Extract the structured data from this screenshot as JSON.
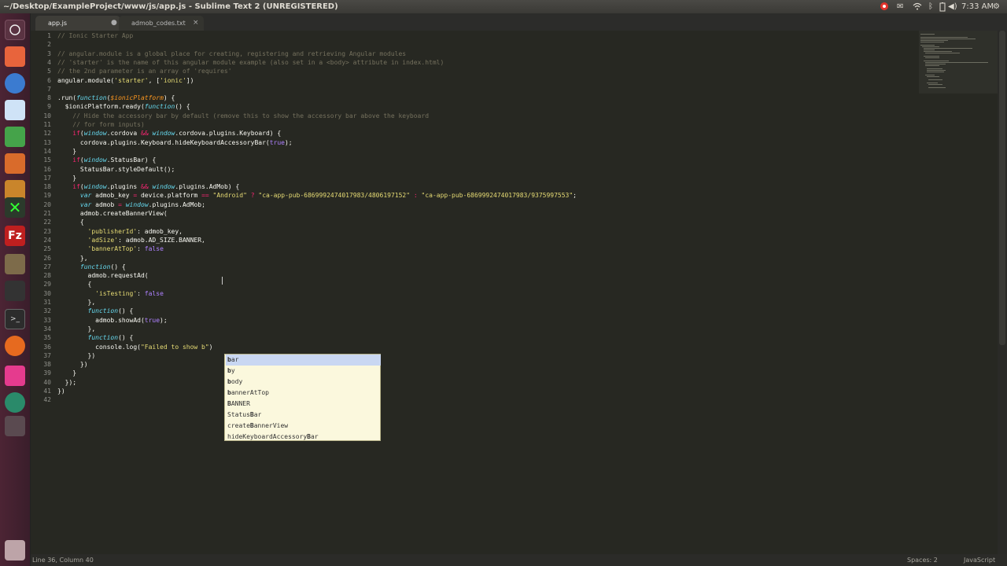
{
  "window": {
    "title": "~/Desktop/ExampleProject/www/js/app.js - Sublime Text 2 (UNREGISTERED)"
  },
  "tray": {
    "time": "7:33 AM",
    "icons": [
      "power-record-icon",
      "mail-icon",
      "wifi-icon",
      "bluetooth-icon",
      "battery-icon",
      "volume-icon",
      "settings-gear-icon"
    ]
  },
  "launcher": {
    "icons": [
      "dash-icon",
      "files-icon",
      "chromium-icon",
      "text-editor-icon",
      "spreadsheet-icon",
      "presentation-icon",
      "software-center-icon",
      "xterm-icon",
      "filezilla-icon",
      "gimp-icon",
      "network-tool-icon",
      "terminal-icon",
      "firefox-icon",
      "flickr-icon",
      "color-app-icon",
      "workspace-icon",
      "trash-icon"
    ]
  },
  "tabs": [
    {
      "label": "app.js",
      "dirty_marker": "●"
    },
    {
      "label": "admob_codes.txt",
      "close": "×"
    }
  ],
  "code_lines": [
    {
      "n": "1",
      "html": "<span class=\"c\">// Ionic Starter App</span>"
    },
    {
      "n": "2",
      "html": ""
    },
    {
      "n": "3",
      "html": "<span class=\"c\">// angular.module is a global place for creating, registering and retrieving Angular modules</span>"
    },
    {
      "n": "4",
      "html": "<span class=\"c\">// 'starter' is the name of this angular module example (also set in a &lt;body&gt; attribute in index.html)</span>"
    },
    {
      "n": "5",
      "html": "<span class=\"c\">// the 2nd parameter is an array of 'requires'</span>"
    },
    {
      "n": "6",
      "html": "angular.module(<span class=\"s\">'starter'</span>, [<span class=\"s\">'ionic'</span>])"
    },
    {
      "n": "7",
      "html": ""
    },
    {
      "n": "8",
      "html": ".run(<span class=\"i\">function</span>(<span class=\"p\">$ionicPlatform</span>) {"
    },
    {
      "n": "9",
      "html": "  $ionicPlatform.ready(<span class=\"i\">function</span>() {"
    },
    {
      "n": "10",
      "html": "    <span class=\"c\">// Hide the accessory bar by default (remove this to show the accessory bar above the keyboard</span>"
    },
    {
      "n": "11",
      "html": "    <span class=\"c\">// for form inputs)</span>"
    },
    {
      "n": "12",
      "html": "    <span class=\"k\">if</span>(<span class=\"i\">window</span>.cordova <span class=\"k\">&amp;&amp;</span> <span class=\"i\">window</span>.cordova.plugins.Keyboard) {"
    },
    {
      "n": "13",
      "html": "      cordova.plugins.Keyboard.hideKeyboardAccessoryBar(<span class=\"n\">true</span>);"
    },
    {
      "n": "14",
      "html": "    }"
    },
    {
      "n": "15",
      "html": "    <span class=\"k\">if</span>(<span class=\"i\">window</span>.StatusBar) {"
    },
    {
      "n": "16",
      "html": "      StatusBar.styleDefault();"
    },
    {
      "n": "17",
      "html": "    }"
    },
    {
      "n": "18",
      "html": "    <span class=\"k\">if</span>(<span class=\"i\">window</span>.plugins <span class=\"k\">&amp;&amp;</span> <span class=\"i\">window</span>.plugins.AdMob) {"
    },
    {
      "n": "19",
      "html": "      <span class=\"i\">var</span> admob_key <span class=\"k\">=</span> device.platform <span class=\"k\">==</span> <span class=\"s\">\"Android\"</span> <span class=\"k\">?</span> <span class=\"s\">\"ca-app-pub-6869992474017983/4806197152\"</span> <span class=\"k\">:</span> <span class=\"s\">\"ca-app-pub-6869992474017983/9375997553\"</span>;"
    },
    {
      "n": "20",
      "html": "      <span class=\"i\">var</span> admob <span class=\"k\">=</span> <span class=\"i\">window</span>.plugins.AdMob;"
    },
    {
      "n": "21",
      "html": "      admob.createBannerView("
    },
    {
      "n": "22",
      "html": "      {"
    },
    {
      "n": "23",
      "html": "        <span class=\"s\">'publisherId'</span>: admob_key,"
    },
    {
      "n": "24",
      "html": "        <span class=\"s\">'adSize'</span>: admob.AD_SIZE.BANNER,"
    },
    {
      "n": "25",
      "html": "        <span class=\"s\">'bannerAtTop'</span>: <span class=\"n\">false</span>"
    },
    {
      "n": "26",
      "html": "      },"
    },
    {
      "n": "27",
      "html": "      <span class=\"i\">function</span>() {"
    },
    {
      "n": "28",
      "html": "        admob.requestAd("
    },
    {
      "n": "29",
      "html": "        {"
    },
    {
      "n": "30",
      "html": "          <span class=\"s\">'isTesting'</span>: <span class=\"n\">false</span>"
    },
    {
      "n": "31",
      "html": "        },"
    },
    {
      "n": "32",
      "html": "        <span class=\"i\">function</span>() {"
    },
    {
      "n": "33",
      "html": "          admob.showAd(<span class=\"n\">true</span>);"
    },
    {
      "n": "34",
      "html": "        },"
    },
    {
      "n": "35",
      "html": "        <span class=\"i\">function</span>() {"
    },
    {
      "n": "36",
      "html": "          console.log(<span class=\"s\">\"Failed to show b\"</span>)"
    },
    {
      "n": "37",
      "html": "        })"
    },
    {
      "n": "38",
      "html": "      })"
    },
    {
      "n": "39",
      "html": "    }"
    },
    {
      "n": "40",
      "html": "  });"
    },
    {
      "n": "41",
      "html": "})"
    },
    {
      "n": "42",
      "html": ""
    }
  ],
  "autocomplete": {
    "items": [
      {
        "pre": "",
        "hl": "b",
        "post": "ar"
      },
      {
        "pre": "",
        "hl": "b",
        "post": "y"
      },
      {
        "pre": "",
        "hl": "b",
        "post": "ody"
      },
      {
        "pre": "",
        "hl": "b",
        "post": "annerAtTop"
      },
      {
        "pre": "",
        "hl": "B",
        "post": "ANNER"
      },
      {
        "pre": "Status",
        "hl": "B",
        "post": "ar"
      },
      {
        "pre": "create",
        "hl": "B",
        "post": "annerView"
      },
      {
        "pre": "hideKeyboardAccessory",
        "hl": "B",
        "post": "ar"
      }
    ],
    "selected_index": 0
  },
  "status": {
    "position": "Line 36, Column 40",
    "spaces": "Spaces: 2",
    "syntax": "JavaScript"
  },
  "colors": {
    "editor_bg": "#272822",
    "comment": "#75715e",
    "keyword": "#f92672",
    "string": "#e6db74",
    "number": "#ae81ff",
    "type": "#66d9ef"
  }
}
